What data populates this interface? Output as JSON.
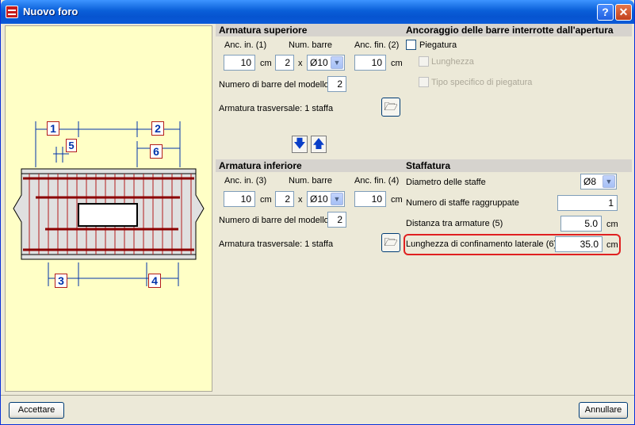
{
  "window": {
    "title": "Nuovo foro"
  },
  "diagram": {
    "dim_labels": [
      "1",
      "2",
      "3",
      "4",
      "5",
      "6"
    ]
  },
  "armatura_superiore": {
    "title": "Armatura superiore",
    "anc_in_label": "Anc. in. (1)",
    "num_barre_label": "Num. barre",
    "anc_fin_label": "Anc. fin. (2)",
    "anc_in_value": "10",
    "unit": "cm",
    "num_barre_value": "2",
    "times": "x",
    "diameter": "Ø10",
    "anc_fin_value": "10",
    "num_modello_label": "Numero di barre del modello",
    "num_modello_value": "2",
    "trasversale": "Armatura trasversale: 1 staffa"
  },
  "ancoraggio": {
    "title": "Ancoraggio delle barre interrotte dall'apertura",
    "piegatura": "Piegatura",
    "lunghezza": "Lunghezza",
    "tipo": "Tipo specifico di piegatura"
  },
  "armatura_inferiore": {
    "title": "Armatura inferiore",
    "anc_in_label": "Anc. in. (3)",
    "num_barre_label": "Num. barre",
    "anc_fin_label": "Anc. fin. (4)",
    "anc_in_value": "10",
    "unit": "cm",
    "num_barre_value": "2",
    "times": "x",
    "diameter": "Ø10",
    "anc_fin_value": "10",
    "num_modello_label": "Numero di barre del modello",
    "num_modello_value": "2",
    "trasversale": "Armatura trasversale: 1 staffa"
  },
  "staffatura": {
    "title": "Staffatura",
    "diametro_label": "Diametro delle staffe",
    "diametro_value": "Ø8",
    "raggruppate_label": "Numero di staffe raggruppate",
    "raggruppate_value": "1",
    "distanza_label": "Distanza tra armature (5)",
    "distanza_value": "5.0",
    "confinamento_label": "Lunghezza di confinamento laterale (6)",
    "confinamento_value": "35.0",
    "unit": "cm"
  },
  "buttons": {
    "accept": "Accettare",
    "cancel": "Annullare"
  },
  "colors": {
    "accent": "#0a5fd8",
    "highlight": "#e02020",
    "diagram_bg": "#ffffc6"
  }
}
